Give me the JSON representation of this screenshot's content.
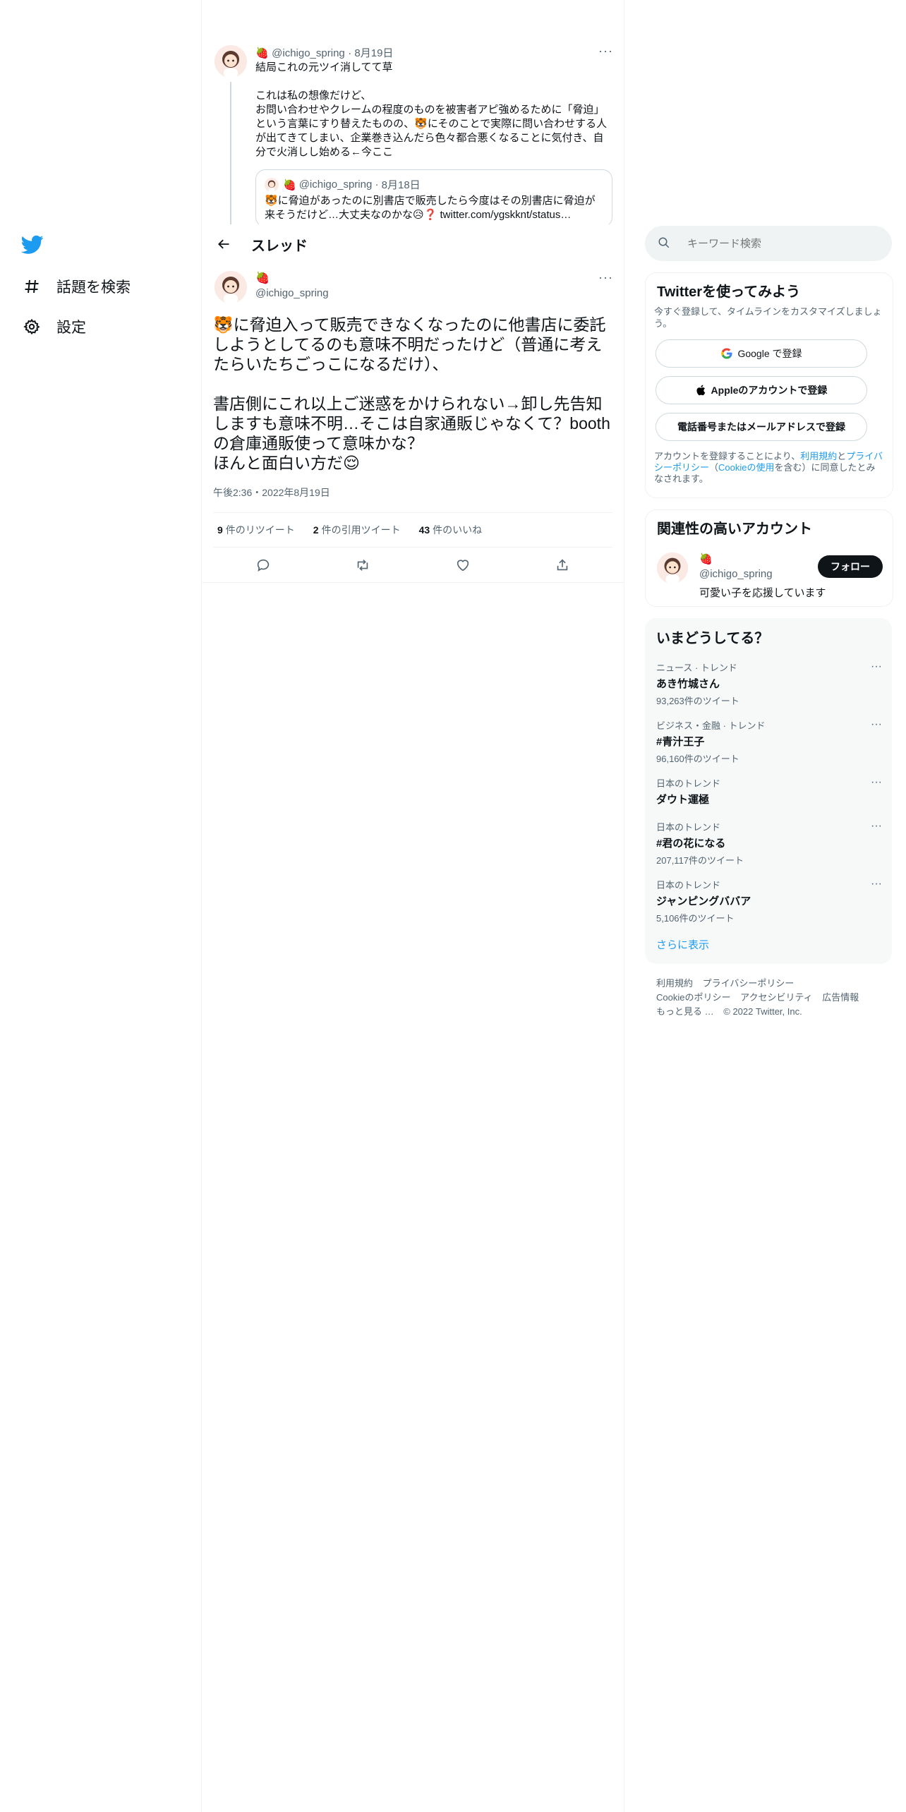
{
  "nav": {
    "logo": "twitter-bird-icon",
    "items": [
      {
        "label": "話題を検索",
        "icon": "hashtag-icon"
      },
      {
        "label": "設定",
        "icon": "gear-icon"
      }
    ]
  },
  "header": {
    "title": "スレッド",
    "back_icon": "arrow-left-icon"
  },
  "parent_tweet": {
    "name_emoji": "🍓",
    "handle": "@ichigo_spring",
    "date": "8月19日",
    "text": "結局これの元ツイ消してて草\n\nこれは私の想像だけど、\nお問い合わせやクレームの程度のものを被害者アピ強めるために「脅迫」という言葉にすり替えたものの、🐯にそのことで実際に問い合わせする人が出てきてしまい、企業巻き込んだら色々都合悪くなることに気付き、自分で火消しし始める←今ここ",
    "quote": {
      "name_emoji": "🍓",
      "handle": "@ichigo_spring",
      "date": "8月18日",
      "text": "🐯に脅迫があったのに別書店で販売したら今度はその別書店に脅迫が来そうだけど…大丈夫なのかな😥❓ twitter.com/ygskknt/status…"
    }
  },
  "main_tweet": {
    "name_emoji": "🍓",
    "handle": "@ichigo_spring",
    "text": "🐯に脅迫入って販売できなくなったのに他書店に委託しようとしてるのも意味不明だったけど（普通に考えたらいたちごっこになるだけ）、\n\n書店側にこれ以上ご迷惑をかけられない→卸し先告知しますも意味不明…そこは自家通販じゃなくて？boothの倉庫通販使って意味かな？\nほんと面白い方だ😌",
    "timestamp": "午後2:36・2022年8月19日",
    "stats": [
      {
        "count": "9",
        "label": "件のリツイート"
      },
      {
        "count": "2",
        "label": "件の引用ツイート"
      },
      {
        "count": "43",
        "label": "件のいいね"
      }
    ],
    "actions": [
      "reply-icon",
      "retweet-icon",
      "like-icon",
      "share-icon"
    ]
  },
  "search": {
    "placeholder": "キーワード検索"
  },
  "signup": {
    "title": "Twitterを使ってみよう",
    "subtitle": "今すぐ登録して、タイムラインをカスタマイズしましょう。",
    "google": "Google で登録",
    "apple": "Appleのアカウントで登録",
    "phone": "電話番号またはメールアドレスで登録",
    "terms_prefix": "アカウントを登録することにより、",
    "terms_link": "利用規約",
    "terms_and": "と",
    "privacy_link": "プライバシーポリシー",
    "cookie_open": "（",
    "cookie_link": "Cookieの使用",
    "cookie_suffix": "を含む）に同意したとみなされます。"
  },
  "related": {
    "title": "関連性の高いアカウント",
    "name_emoji": "🍓",
    "handle": "@ichigo_spring",
    "bio": "可愛い子を応援しています",
    "follow_label": "フォロー"
  },
  "trends": {
    "title": "いまどうしてる？",
    "items": [
      {
        "category": "ニュース · トレンド",
        "name": "あき竹城さん",
        "count": "93,263件のツイート"
      },
      {
        "category": "ビジネス・金融 · トレンド",
        "name": "#青汁王子",
        "count": "96,160件のツイート"
      },
      {
        "category": "日本のトレンド",
        "name": "ダウト運極",
        "count": ""
      },
      {
        "category": "日本のトレンド",
        "name": "#君の花になる",
        "count": "207,117件のツイート"
      },
      {
        "category": "日本のトレンド",
        "name": "ジャンピングババア",
        "count": "5,106件のツイート"
      }
    ],
    "show_more": "さらに表示"
  },
  "footer": {
    "links": [
      "利用規約",
      "プライバシーポリシー",
      "Cookieのポリシー",
      "アクセシビリティ",
      "広告情報",
      "もっと見る …"
    ],
    "copyright": "© 2022 Twitter, Inc."
  },
  "colors": {
    "accent": "#1d9bf0",
    "text": "#0f1419",
    "muted": "#536471",
    "border": "#eff3f4"
  }
}
